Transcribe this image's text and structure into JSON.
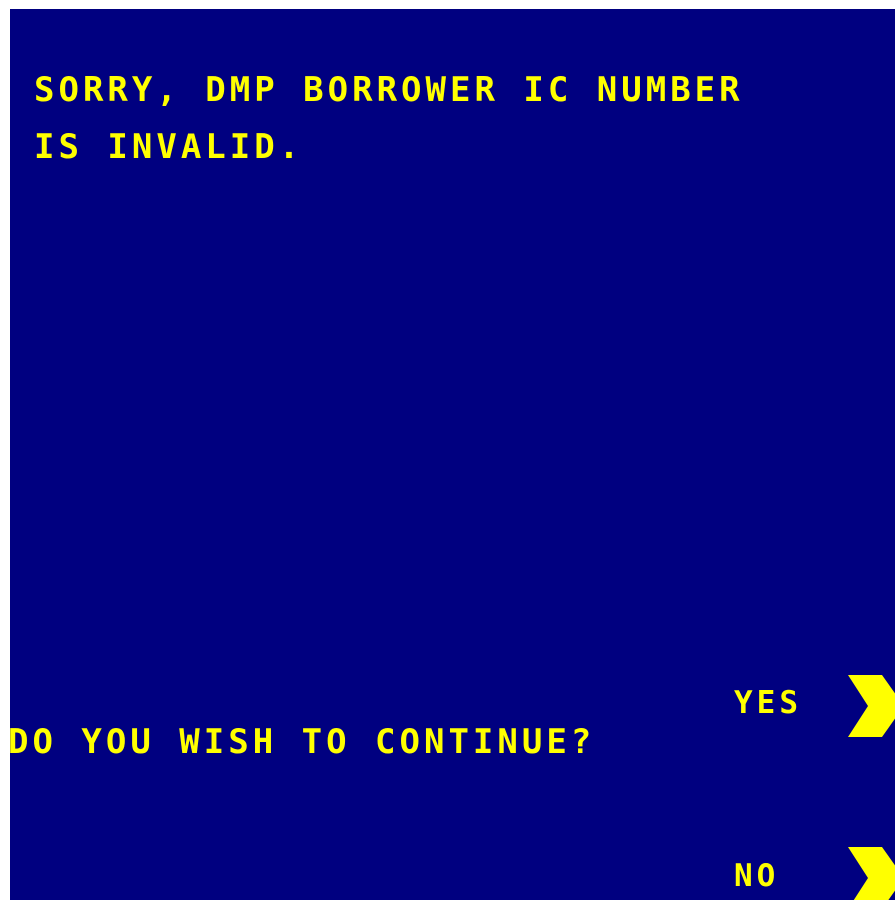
{
  "message": {
    "line1": "SORRY, DMP BORROWER IC NUMBER",
    "line2": "IS INVALID."
  },
  "prompt": "DO YOU WISH TO CONTINUE?",
  "options": {
    "yes": {
      "label": "YES",
      "icon": "chevron-right-icon"
    },
    "no": {
      "label": "NO",
      "icon": "chevron-right-icon"
    }
  },
  "colors": {
    "background": "#000080",
    "text": "#FFFF00"
  }
}
